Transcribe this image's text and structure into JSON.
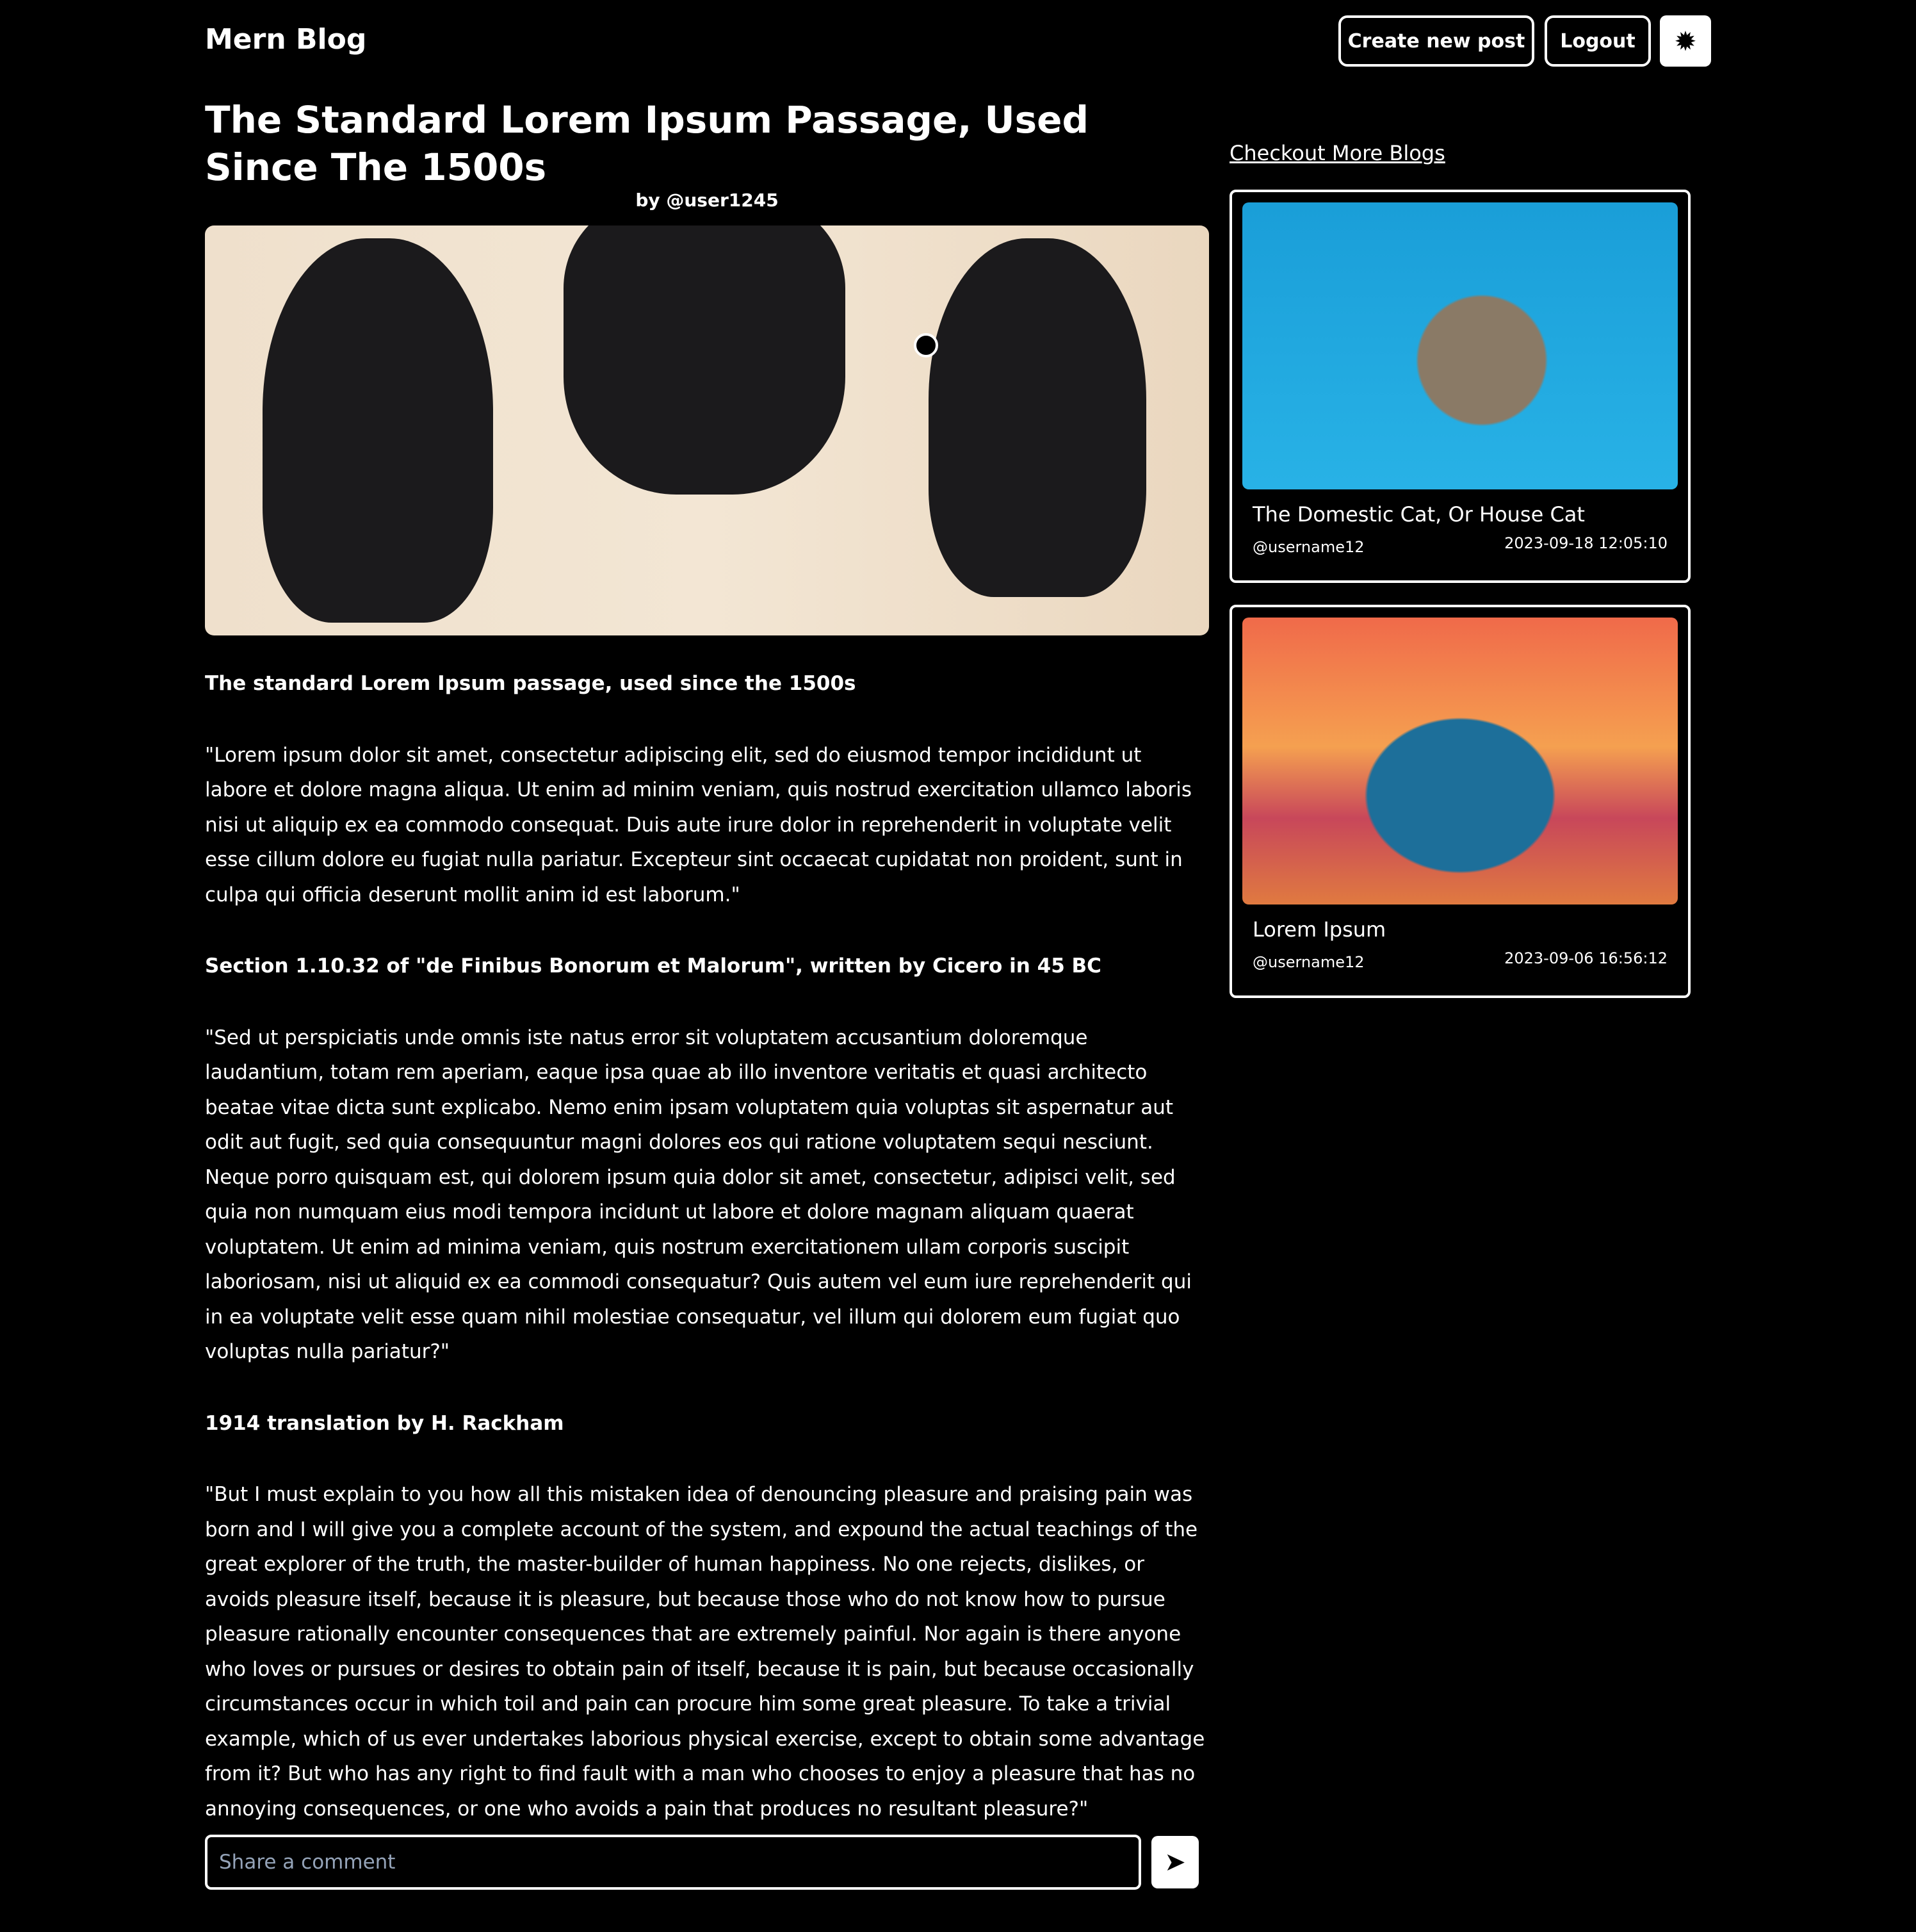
{
  "header": {
    "logo": "Mern Blog",
    "create_label": "Create new post",
    "logout_label": "Logout",
    "theme_icon": "sun-icon"
  },
  "post": {
    "title": "The Standard Lorem Ipsum Passage, Used Since The 1500s",
    "author": "by @user1245",
    "sections": [
      {
        "heading": "The standard Lorem Ipsum passage, used since the 1500s",
        "body": "\"Lorem ipsum dolor sit amet, consectetur adipiscing elit, sed do eiusmod tempor incididunt ut labore et dolore magna aliqua. Ut enim ad minim veniam, quis nostrud exercitation ullamco laboris nisi ut aliquip ex ea commodo consequat. Duis aute irure dolor in reprehenderit in voluptate velit esse cillum dolore eu fugiat nulla pariatur. Excepteur sint occaecat cupidatat non proident, sunt in culpa qui officia deserunt mollit anim id est laborum.\""
      },
      {
        "heading": "Section 1.10.32 of \"de Finibus Bonorum et Malorum\", written by Cicero in 45 BC",
        "body": "\"Sed ut perspiciatis unde omnis iste natus error sit voluptatem accusantium doloremque laudantium, totam rem aperiam, eaque ipsa quae ab illo inventore veritatis et quasi architecto beatae vitae dicta sunt explicabo. Nemo enim ipsam voluptatem quia voluptas sit aspernatur aut odit aut fugit, sed quia consequuntur magni dolores eos qui ratione voluptatem sequi nesciunt. Neque porro quisquam est, qui dolorem ipsum quia dolor sit amet, consectetur, adipisci velit, sed quia non numquam eius modi tempora incidunt ut labore et dolore magnam aliquam quaerat voluptatem. Ut enim ad minima veniam, quis nostrum exercitationem ullam corporis suscipit laboriosam, nisi ut aliquid ex ea commodi consequatur? Quis autem vel eum iure reprehenderit qui in ea voluptate velit esse quam nihil molestiae consequatur, vel illum qui dolorem eum fugiat quo voluptas nulla pariatur?\""
      },
      {
        "heading": "1914 translation by H. Rackham",
        "body": "\"But I must explain to you how all this mistaken idea of denouncing pleasure and praising pain was born and I will give you a complete account of the system, and expound the actual teachings of the great explorer of the truth, the master-builder of human happiness. No one rejects, dislikes, or avoids pleasure itself, because it is pleasure, but because those who do not know how to pursue pleasure rationally encounter consequences that are extremely painful. Nor again is there anyone who loves or pursues or desires to obtain pain of itself, because it is pain, but because occasionally circumstances occur in which toil and pain can procure him some great pleasure. To take a trivial example, which of us ever undertakes laborious physical exercise, except to obtain some advantage from it? But who has any right to find fault with a man who chooses to enjoy a pleasure that has no annoying consequences, or one who avoids a pain that produces no resultant pleasure?\""
      }
    ]
  },
  "comment": {
    "placeholder": "Share a comment",
    "send_icon": "paper-plane-icon"
  },
  "sidebar": {
    "heading": "Checkout More Blogs",
    "cards": [
      {
        "title": "The Domestic Cat, Or House Cat",
        "user": "@username12",
        "date": "2023-09-18 12:05:10"
      },
      {
        "title": "Lorem Ipsum",
        "user": "@username12",
        "date": "2023-09-06 16:56:12"
      }
    ]
  }
}
